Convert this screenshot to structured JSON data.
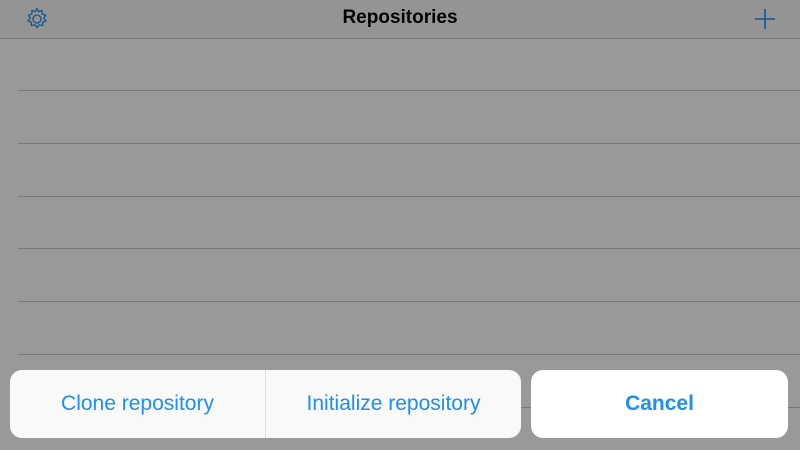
{
  "navbar": {
    "title": "Repositories",
    "left_icon": "gear-icon",
    "right_icon": "plus-icon"
  },
  "list": {
    "rows": [
      {
        "label": ""
      },
      {
        "label": ""
      },
      {
        "label": ""
      },
      {
        "label": ""
      },
      {
        "label": ""
      },
      {
        "label": ""
      },
      {
        "label": ""
      }
    ]
  },
  "action_sheet": {
    "clone_label": "Clone repository",
    "initialize_label": "Initialize repository",
    "cancel_label": "Cancel"
  },
  "colors": {
    "accent": "#1c8ef5",
    "background": "#f7f7f7",
    "dim_overlay": "rgba(0,0,0,0.40)"
  }
}
